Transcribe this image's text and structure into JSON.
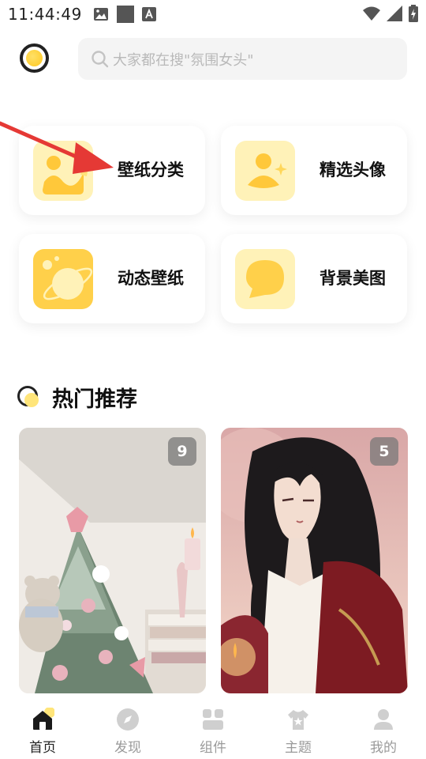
{
  "status_bar": {
    "time": "11:44:49",
    "icons_left": [
      "image-icon",
      "square-icon",
      "a-icon"
    ],
    "icons_right": [
      "wifi-icon",
      "signal-icon",
      "battery-icon"
    ]
  },
  "header": {
    "logo": "app-logo",
    "search": {
      "placeholder": "大家都在搜\"氛围女头\"",
      "icon": "search-icon"
    }
  },
  "categories": [
    {
      "label": "壁纸分类",
      "icon": "wallpaper-category-icon"
    },
    {
      "label": "精选头像",
      "icon": "avatar-icon"
    },
    {
      "label": "动态壁纸",
      "icon": "planet-icon"
    },
    {
      "label": "背景美图",
      "icon": "chat-bubble-icon"
    }
  ],
  "hot_section": {
    "title": "热门推荐",
    "items": [
      {
        "count": "9",
        "subject": "christmas-tree-photo"
      },
      {
        "count": "5",
        "subject": "anime-character-illustration"
      }
    ]
  },
  "bottom_nav": {
    "items": [
      {
        "label": "首页",
        "icon": "home-icon",
        "active": true
      },
      {
        "label": "发现",
        "icon": "discover-icon",
        "active": false
      },
      {
        "label": "组件",
        "icon": "widgets-icon",
        "active": false
      },
      {
        "label": "主题",
        "icon": "theme-shirt-icon",
        "active": false
      },
      {
        "label": "我的",
        "icon": "profile-icon",
        "active": false
      }
    ]
  },
  "colors": {
    "accent_yellow": "#ffd94d",
    "light_yellow": "#fff2b8",
    "arrow_red": "#e53935"
  }
}
